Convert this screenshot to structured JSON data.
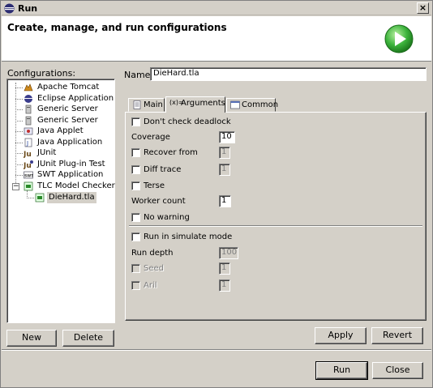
{
  "window": {
    "title": "Run",
    "close_glyph": "×"
  },
  "header": {
    "heading": "Create, manage, and run configurations",
    "logo_icon": "run-play-icon"
  },
  "configurations": {
    "label": "Configurations:",
    "items": [
      {
        "label": "Apache Tomcat",
        "icon": "tomcat-icon"
      },
      {
        "label": "Eclipse Application",
        "icon": "eclipse-icon"
      },
      {
        "label": "Generic Server",
        "icon": "server-icon"
      },
      {
        "label": "Generic Server",
        "icon": "server-icon"
      },
      {
        "label": "Java Applet",
        "icon": "java-applet-icon"
      },
      {
        "label": "Java Application",
        "icon": "java-application-icon"
      },
      {
        "label": "JUnit",
        "icon": "junit-icon"
      },
      {
        "label": "JUnit Plug-in Test",
        "icon": "junit-plugin-icon"
      },
      {
        "label": "SWT Application",
        "icon": "swt-icon"
      },
      {
        "label": "TLC Model Checker",
        "icon": "tlc-icon",
        "expanded": true
      },
      {
        "label": "DieHard.tla",
        "icon": "tla-file-icon",
        "selected": true
      }
    ],
    "expander_glyph": "−",
    "new_button": "New",
    "delete_button": "Delete"
  },
  "editor": {
    "name_label": "Name:",
    "name_value": "DieHard.tla",
    "tabs": [
      {
        "label": "Main",
        "icon": "main-tab-icon"
      },
      {
        "label": "Arguments",
        "icon": "arguments-tab-icon",
        "active": true,
        "icon_text": "(x)="
      },
      {
        "label": "Common",
        "icon": "common-tab-icon"
      }
    ],
    "args": {
      "dont_check_deadlock": {
        "label": "Don't check deadlock",
        "checked": false
      },
      "coverage": {
        "label": "Coverage",
        "value": "10"
      },
      "recover_from": {
        "label": "Recover from",
        "checked": false,
        "value": "1"
      },
      "diff_trace": {
        "label": "Diff trace",
        "checked": false,
        "value": "1"
      },
      "terse": {
        "label": "Terse",
        "checked": false
      },
      "worker_count": {
        "label": "Worker count",
        "value": "1"
      },
      "no_warning": {
        "label": "No warning",
        "checked": false
      },
      "run_in_simulate_mode": {
        "label": "Run in simulate mode",
        "checked": false
      },
      "run_depth": {
        "label": "Run depth",
        "value": "100"
      },
      "seed": {
        "label": "Seed",
        "checked": false,
        "value": "1",
        "disabled": true
      },
      "aril": {
        "label": "Aril",
        "checked": false,
        "value": "1",
        "disabled": true
      }
    },
    "apply_button": "Apply",
    "revert_button": "Revert"
  },
  "footer": {
    "run_button": "Run",
    "close_button": "Close"
  },
  "colors": {
    "dialog_bg": "#d4d0c8",
    "run_green": "#3cb33c",
    "selection": "#d4d0c8"
  }
}
